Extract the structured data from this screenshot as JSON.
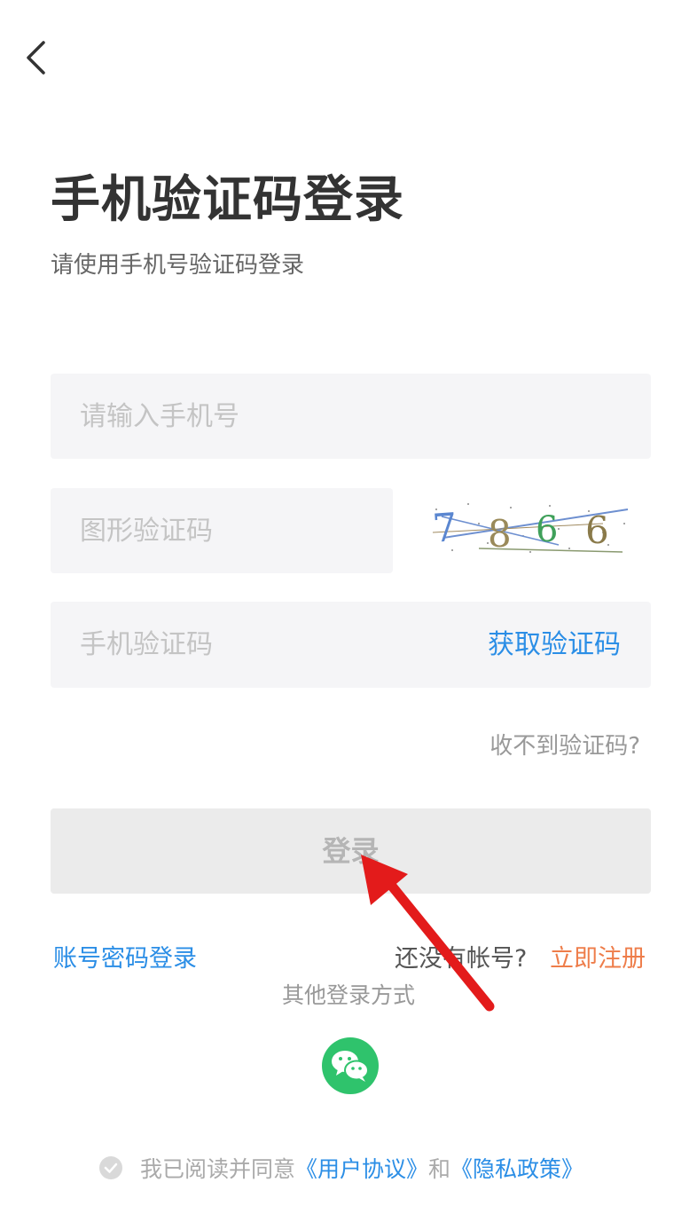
{
  "header": {
    "back_icon": "chevron-left-icon"
  },
  "title": "手机验证码登录",
  "subtitle": "请使用手机号验证码登录",
  "form": {
    "phone_placeholder": "请输入手机号",
    "captcha_placeholder": "图形验证码",
    "captcha_text": "7866",
    "sms_placeholder": "手机验证码",
    "get_code_label": "获取验证码",
    "no_code_label": "收不到验证码?",
    "login_label": "登录"
  },
  "links": {
    "password_login": "账号密码登录",
    "no_account": "还没有帐号?",
    "register": "立即注册"
  },
  "other_login": {
    "label": "其他登录方式",
    "wechat_icon": "wechat-icon"
  },
  "agreement": {
    "prefix": "我已阅读并同意",
    "user_agreement": "《用户协议》",
    "and": "和",
    "privacy_policy": "《隐私政策》"
  },
  "colors": {
    "link_blue": "#2b8ee6",
    "register_orange": "#ee7d4a",
    "wechat_green": "#2fc36c",
    "annotation_red": "#e31b1b"
  }
}
